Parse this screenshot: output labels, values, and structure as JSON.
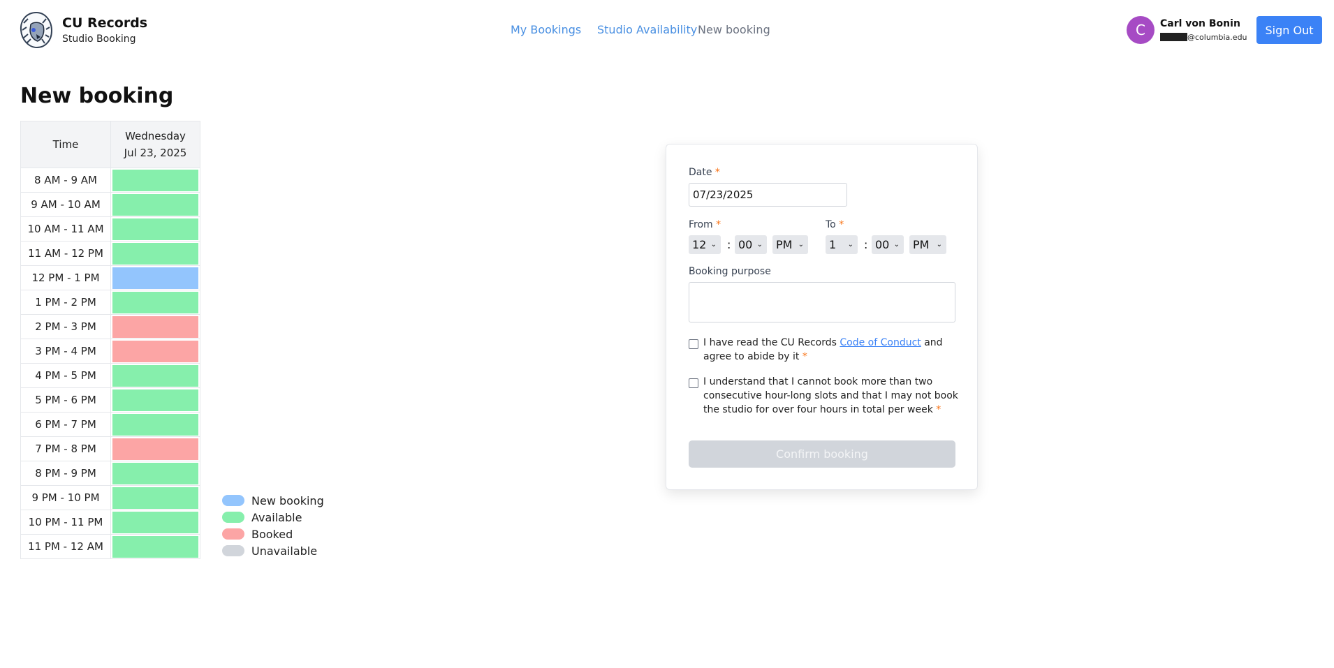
{
  "brand": {
    "title": "CU Records",
    "subtitle": "Studio Booking"
  },
  "nav": {
    "my_bookings": "My Bookings",
    "studio_availability": "Studio Availability",
    "new_booking": "New booking"
  },
  "user": {
    "initial": "C",
    "name": "Carl von Bonin",
    "email_domain": "@columbia.edu"
  },
  "signout_label": "Sign Out",
  "page_title": "New booking",
  "schedule": {
    "time_header": "Time",
    "day_name": "Wednesday",
    "day_date": "Jul 23, 2025",
    "rows": [
      {
        "time": "8 AM - 9 AM",
        "status": "available"
      },
      {
        "time": "9 AM - 10 AM",
        "status": "available"
      },
      {
        "time": "10 AM - 11 AM",
        "status": "available"
      },
      {
        "time": "11 AM - 12 PM",
        "status": "available"
      },
      {
        "time": "12 PM - 1 PM",
        "status": "new"
      },
      {
        "time": "1 PM - 2 PM",
        "status": "available"
      },
      {
        "time": "2 PM - 3 PM",
        "status": "booked"
      },
      {
        "time": "3 PM - 4 PM",
        "status": "booked"
      },
      {
        "time": "4 PM - 5 PM",
        "status": "available"
      },
      {
        "time": "5 PM - 6 PM",
        "status": "available"
      },
      {
        "time": "6 PM - 7 PM",
        "status": "available"
      },
      {
        "time": "7 PM - 8 PM",
        "status": "booked"
      },
      {
        "time": "8 PM - 9 PM",
        "status": "available"
      },
      {
        "time": "9 PM - 10 PM",
        "status": "available"
      },
      {
        "time": "10 PM - 11 PM",
        "status": "available"
      },
      {
        "time": "11 PM - 12 AM",
        "status": "available"
      }
    ]
  },
  "legend": [
    {
      "key": "new",
      "label": "New booking",
      "color": "#93c5fd"
    },
    {
      "key": "available",
      "label": "Available",
      "color": "#86efac"
    },
    {
      "key": "booked",
      "label": "Booked",
      "color": "#fca5a5"
    },
    {
      "key": "unavailable",
      "label": "Unavailable",
      "color": "#d1d5db"
    }
  ],
  "form": {
    "date_label": "Date",
    "date_value": "07/23/2025",
    "from_label": "From",
    "to_label": "To",
    "from_hour": "12",
    "from_minute": "00",
    "from_ampm": "PM",
    "to_hour": "1",
    "to_minute": "00",
    "to_ampm": "PM",
    "colon": ":",
    "required_mark": "*",
    "purpose_label": "Booking purpose",
    "purpose_value": "",
    "conduct_pre": "I have read the CU Records ",
    "conduct_link": "Code of Conduct",
    "conduct_post": " and agree to abide by it",
    "limit_text": "I understand that I cannot book more than two consecutive hour-long slots and that I may not book the studio for over four hours in total per week",
    "confirm_label": "Confirm booking"
  }
}
